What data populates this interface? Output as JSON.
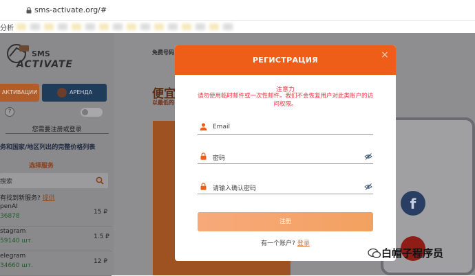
{
  "browser": {
    "url": "sms-activate.org/#",
    "bookmarks_label": "分析"
  },
  "sidebar": {
    "logo_top": "SMS",
    "logo_bottom": "ACTIVATE",
    "tab_activate": "АКТИВАЦИИ",
    "tab_rent": "АРЕНДА",
    "help": "?",
    "need_register": "您需要注册或登录",
    "price_list_link": "务和国家/地区列出的完整价格列表",
    "select_service": "选择服务",
    "search_placeholder": "搜索",
    "not_found_text": "有找到新服务?",
    "not_found_link": "提供",
    "services": [
      {
        "name": "penAI",
        "count": "36878",
        "price": "15 ₽"
      },
      {
        "name": "stagram",
        "count": "59140 шт.",
        "price": "1.5 ₽"
      },
      {
        "name": "elegram",
        "count": "34660 шт.",
        "price": "12 ₽"
      }
    ]
  },
  "main": {
    "free_numbers": "免费号码",
    "headline": "便宜",
    "subline": "以最低的"
  },
  "modal": {
    "title": "РЕГИСТРАЦИЯ",
    "close": "×",
    "warning_title": "注意力",
    "warning_body": "请勿使用临时邮件或一次性邮件。我们不会恢复用户对此类账户的访问权限。",
    "email_placeholder": "Email",
    "password_placeholder": "密码",
    "confirm_placeholder": "请输入确认密码",
    "register_button": "注册",
    "have_account": "有一个账户?",
    "login_link": "登录"
  },
  "watermark": {
    "text": "白帽子程序员"
  },
  "colors": {
    "accent": "#ee5e18",
    "warning": "#e8343f",
    "button": "#f5a56d"
  }
}
